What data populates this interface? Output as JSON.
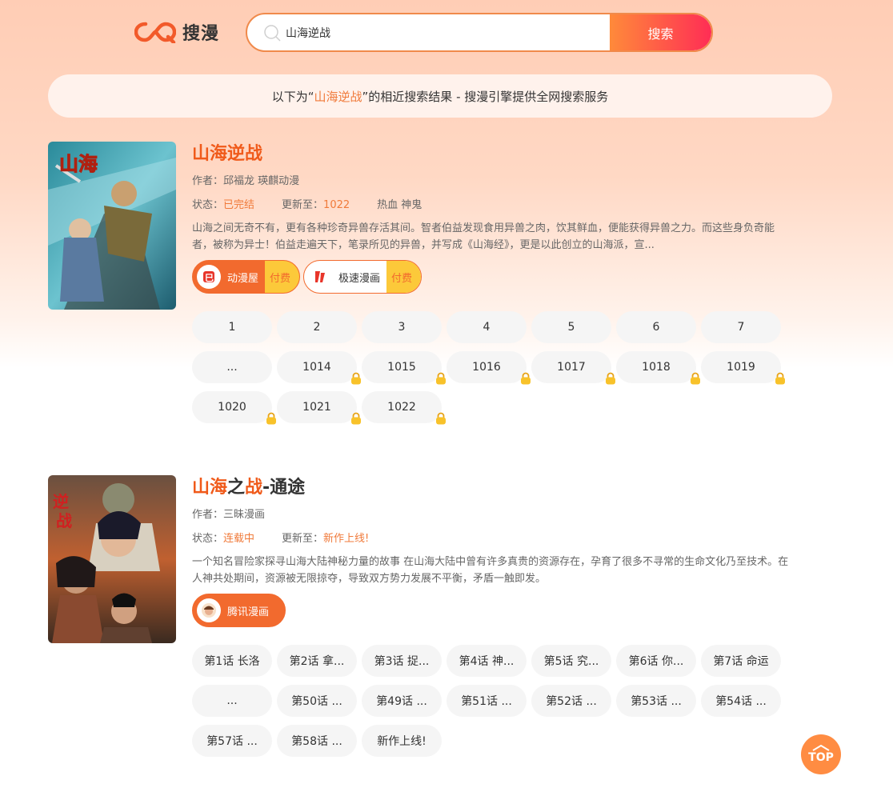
{
  "header": {
    "logo_text": "搜漫",
    "search_value": "山海逆战",
    "search_button": "搜索"
  },
  "notice": {
    "prefix": "以下为“",
    "keyword": "山海逆战",
    "suffix": "”的相近搜索结果 - 搜漫引擎提供全网搜索服务"
  },
  "results": [
    {
      "title": "山海逆战",
      "author_label": "作者：",
      "author": "邱福龙  瑛麒动漫",
      "status_label": "状态：",
      "status": "已完结",
      "update_label": "更新至：",
      "update": "1022",
      "tags": "热血  神鬼",
      "desc": "山海之间无奇不有，更有各种珍奇异兽存活其间。智者伯益发现食用异兽之肉，饮其鲜血，便能获得异兽之力。而这些身负奇能者，被称为异士！伯益走遍天下，笔录所见的异兽，并写成《山海经》，更是以此创立的山海派，宣...",
      "sources": [
        {
          "name": "动漫屋",
          "pay": "付费"
        },
        {
          "name": "极速漫画",
          "pay": "付费"
        }
      ],
      "episodes": [
        "1",
        "2",
        "3",
        "4",
        "5",
        "6",
        "7",
        "...",
        "1014",
        "1015",
        "1016",
        "1017",
        "1018",
        "1019",
        "1020",
        "1021",
        "1022"
      ]
    },
    {
      "title_part1": "山海",
      "title_part2": "之",
      "title_part3": "战",
      "title_part4": "-通途",
      "author_label": "作者：",
      "author": "三昧漫画",
      "status_label": "状态：",
      "status": "连载中",
      "update_label": "更新至：",
      "update": "新作上线!",
      "desc": "一个知名冒险家探寻山海大陆神秘力量的故事 在山海大陆中曾有许多真贵的资源存在，孕育了很多不寻常的生命文化乃至技术。在人神共处期间，资源被无限掠夺，导致双方势力发展不平衡，矛盾一触即发。",
      "sources": [
        {
          "name": "腾讯漫画"
        }
      ],
      "episodes": [
        "第1话 长洛",
        "第2话 拿...",
        "第3话 捉...",
        "第4话 神...",
        "第5话 究...",
        "第6话 你...",
        "第7话 命运",
        "...",
        "第50话 ...",
        "第49话 ...",
        "第51话 ...",
        "第52话 ...",
        "第53话 ...",
        "第54话 ...",
        "第57话 ...",
        "第58话 ...",
        "新作上线!"
      ]
    }
  ],
  "top_button": "TOP",
  "colors": {
    "accent": "#f26a2e",
    "pay": "#fcc93a",
    "lock": "#f5b820"
  }
}
